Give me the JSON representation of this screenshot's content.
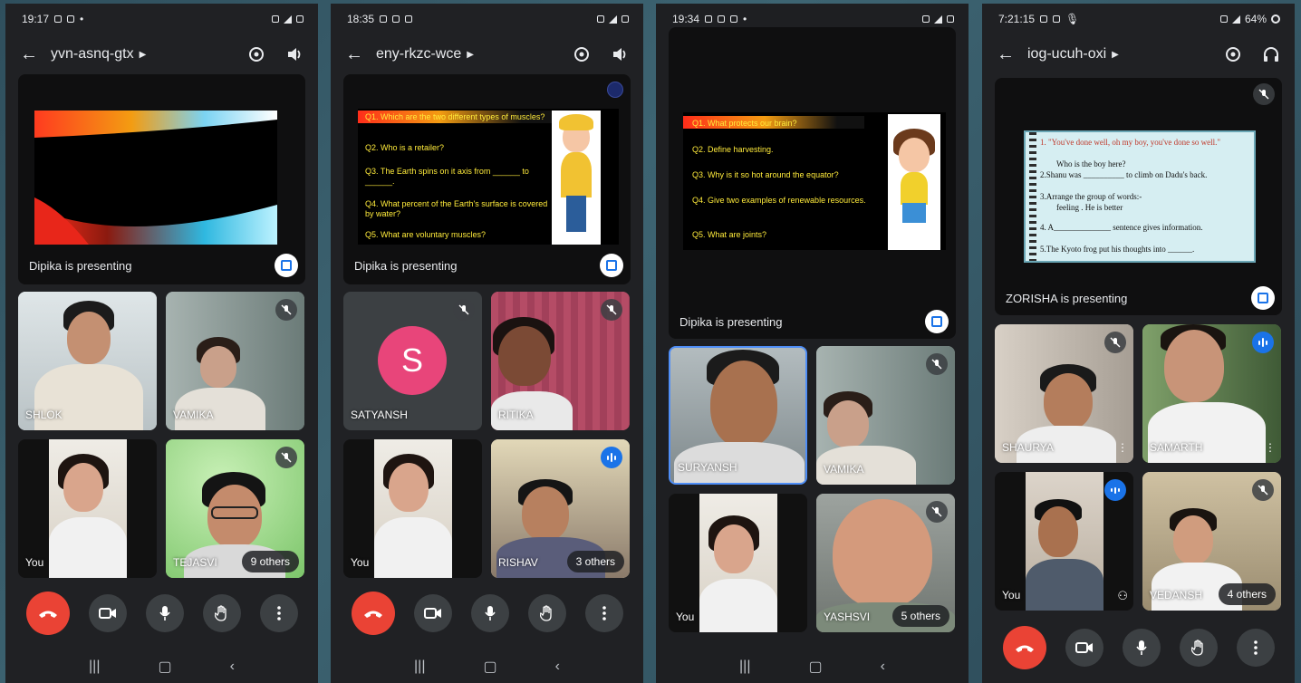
{
  "phones": [
    {
      "time": "19:17",
      "meeting_code": "yvn-asnq-gtx",
      "presenter_label": "Dipika is presenting",
      "tiles": [
        "SHLOK",
        "VAMIKA",
        "You",
        "TEJASVI"
      ],
      "others_count": "9 others"
    },
    {
      "time": "18:35",
      "meeting_code": "eny-rkzc-wce",
      "presenter_label": "Dipika is presenting",
      "avatar_letter": "S",
      "tiles": [
        "SATYANSH",
        "RITIKA",
        "You",
        "RISHAV"
      ],
      "others_count": "3 others",
      "slide_questions": [
        "Q1. Which are the two different types of muscles?",
        "Q2. Who is a retailer?",
        "Q3. The Earth spins on it axis from ______ to ______.",
        "Q4. What percent of the Earth's surface is covered by water?",
        "Q5. What are voluntary muscles?"
      ]
    },
    {
      "time": "19:34",
      "presenter_label": "Dipika is presenting",
      "tiles": [
        "SURYANSH",
        "VAMIKA",
        "You",
        "YASHSVI"
      ],
      "others_count": "5 others",
      "slide_questions": [
        "Q1. What protects our brain?",
        "Q2. Define harvesting.",
        "Q3. Why is it so hot around the equator?",
        "Q4. Give two examples of renewable resources.",
        "Q5. What are joints?"
      ]
    },
    {
      "time": "7:21:15",
      "battery": "64%",
      "meeting_code": "iog-ucuh-oxi",
      "presenter_label": "ZORISHA is presenting",
      "tiles": [
        "SHAURYA",
        "SAMARTH",
        "You",
        "VEDANSH"
      ],
      "others_count": "4 others",
      "worksheet_lines": [
        "1.  \"You've done well, oh my boy, you've done so well.\"",
        "Who is the boy here?",
        "2.Shanu was __________ to climb on Dadu's back.",
        "3.Arrange the group of words:-",
        "feeling  .  He  is  better",
        "4. A______________ sentence gives information.",
        "5.The Kyoto frog put his thoughts into ______."
      ]
    }
  ],
  "colors": {
    "bg": "#202124",
    "end_call": "#ea4335",
    "accent_blue": "#1a73e8",
    "slide_text": "#ffeb3b",
    "avatar_pink": "#e8457a"
  }
}
